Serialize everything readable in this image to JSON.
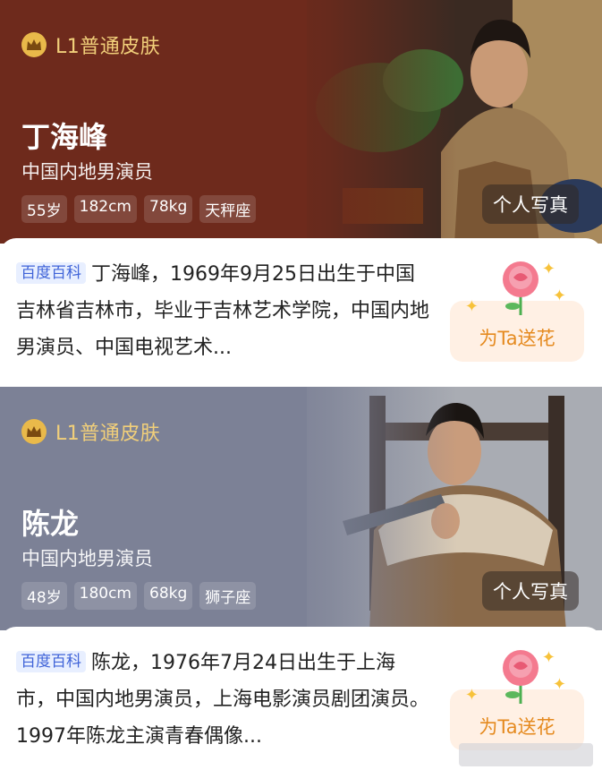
{
  "cards": [
    {
      "skin_label": "L1普通皮肤",
      "name": "丁海峰",
      "title": "中国内地男演员",
      "tags": [
        "55岁",
        "182cm",
        "78kg",
        "天秤座"
      ],
      "album_label": "个人写真",
      "source_badge": "百度百科",
      "bio": "丁海峰，1969年9月25日出生于中国吉林省吉林市，毕业于吉林艺术学院，中国内地男演员、中国电视艺术...",
      "flower_label": "为Ta送花",
      "theme_color": "#6e2a1c"
    },
    {
      "skin_label": "L1普通皮肤",
      "name": "陈龙",
      "title": "中国内地男演员",
      "tags": [
        "48岁",
        "180cm",
        "68kg",
        "狮子座"
      ],
      "album_label": "个人写真",
      "source_badge": "百度百科",
      "bio": "陈龙，1976年7月24日出生于上海市，中国内地男演员，上海电影演员剧团演员。1997年陈龙主演青春偶像...",
      "flower_label": "为Ta送花",
      "theme_color": "#7c8196"
    }
  ],
  "colors": {
    "skin_gold": "#f1cf7a",
    "baike_blue": "#3f63d8",
    "flower_orange": "#e58a1f"
  },
  "icons": [
    "crown-icon",
    "rose-icon",
    "sparkle-icon"
  ]
}
